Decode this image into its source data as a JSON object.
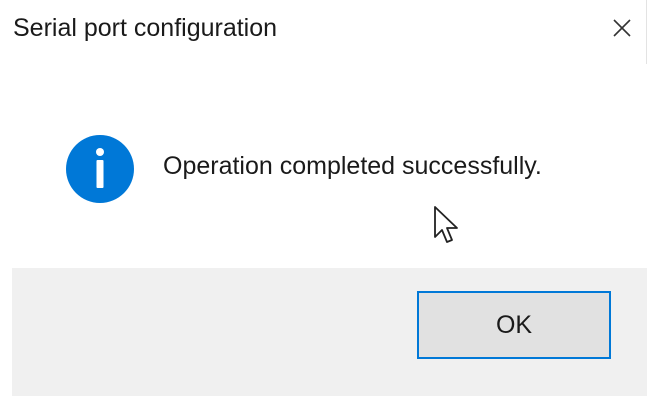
{
  "dialog": {
    "title": "Serial port configuration",
    "message": "Operation completed successfully.",
    "ok_label": "OK",
    "icon": "info-icon",
    "close_icon": "close-icon"
  },
  "colors": {
    "accent": "#0078d7",
    "footer_bg": "#f0f0f0",
    "button_bg": "#e1e1e1"
  }
}
